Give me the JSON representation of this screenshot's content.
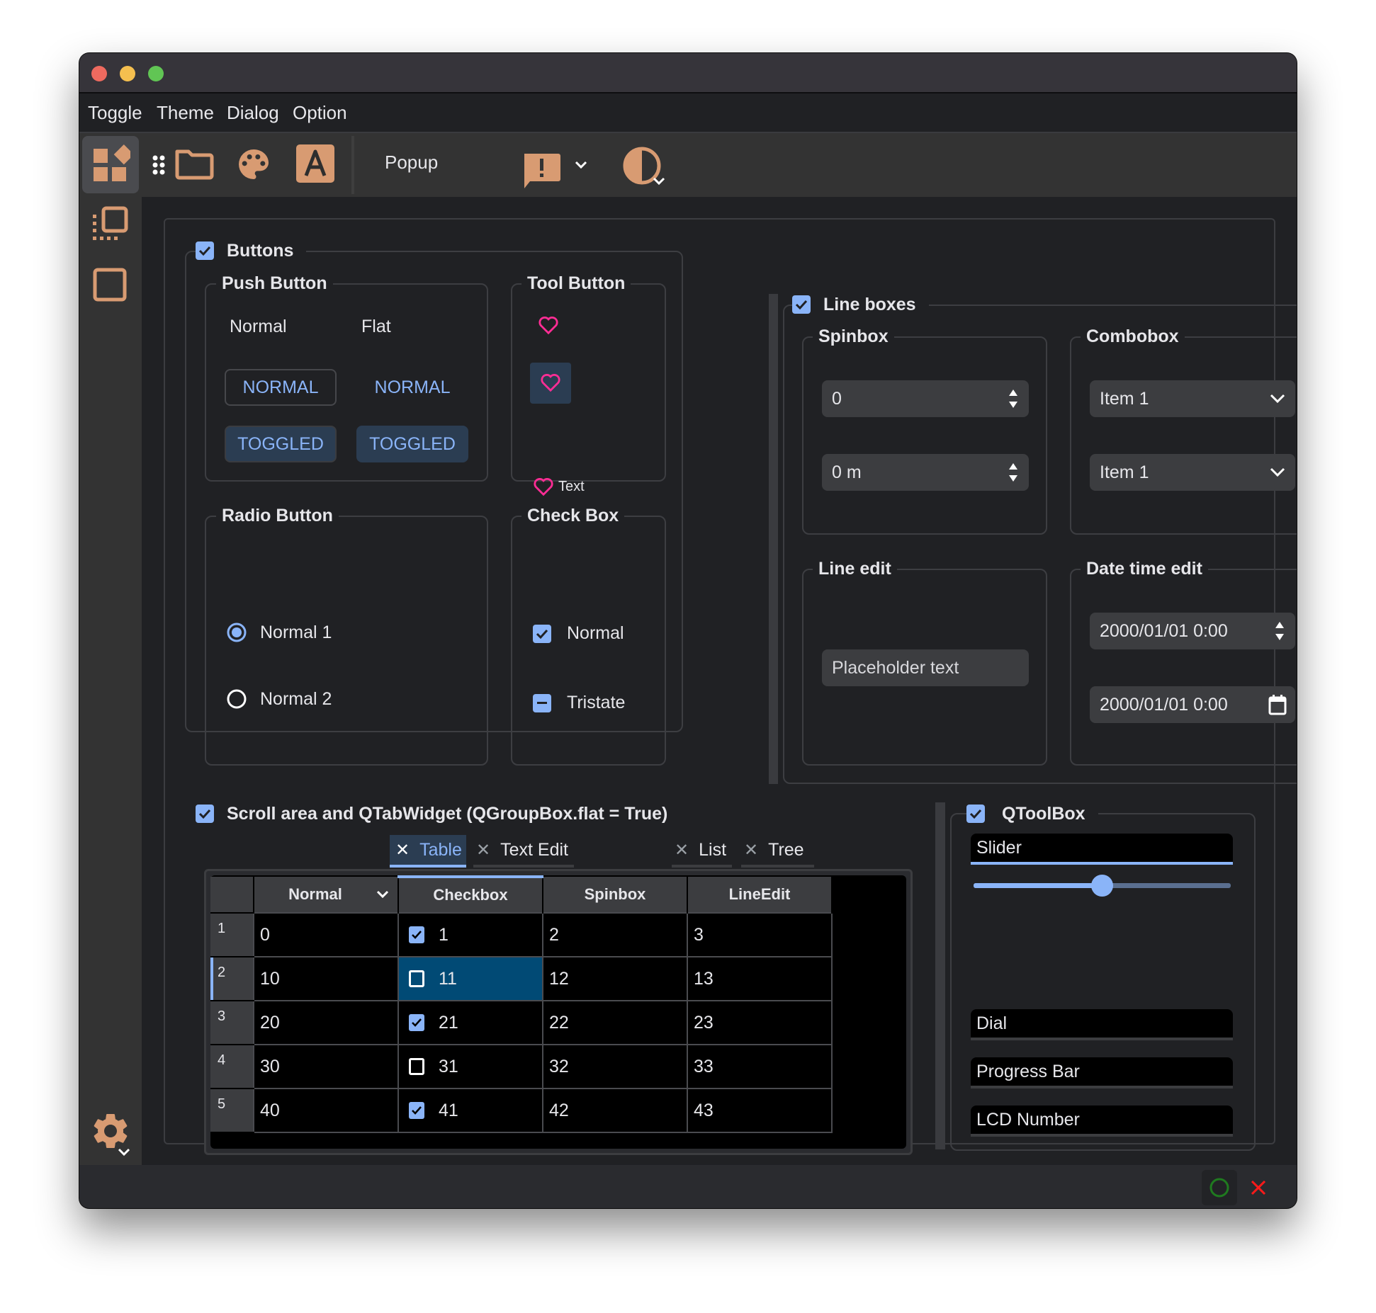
{
  "window": {
    "traffic_lights": [
      {
        "name": "close",
        "color": "#ee6a5f"
      },
      {
        "name": "minimize",
        "color": "#f5bf4f"
      },
      {
        "name": "zoom",
        "color": "#61c554"
      }
    ]
  },
  "menubar": {
    "items": [
      "Toggle",
      "Theme",
      "Dialog",
      "Option"
    ]
  },
  "toolbar": {
    "popup_label": "Popup",
    "icons": [
      "drag-handle-icon",
      "folder-icon",
      "palette-icon",
      "font-icon",
      "feedback-icon",
      "contrast-icon"
    ]
  },
  "sidebar": {
    "icons": [
      "widgets-icon",
      "flip-to-front-icon",
      "crop-square-icon",
      "settings-icon"
    ]
  },
  "colors": {
    "accent": "#d89b72",
    "primary": "#8ab4f8",
    "heart": "#ff2d95",
    "background": "#202124"
  },
  "buttons_group": {
    "title": "Buttons",
    "checked": true,
    "push_button": {
      "title": "Push Button",
      "col_labels": [
        "Normal",
        "Flat"
      ],
      "normal": [
        "NORMAL",
        "NORMAL"
      ],
      "toggled": [
        "TOGGLED",
        "TOGGLED"
      ]
    },
    "tool_button": {
      "title": "Tool Button",
      "text_label": "Text"
    },
    "radio_button": {
      "title": "Radio Button",
      "items": [
        {
          "label": "Normal 1",
          "checked": true
        },
        {
          "label": "Normal 2",
          "checked": false
        }
      ]
    },
    "check_box": {
      "title": "Check Box",
      "items": [
        {
          "label": "Normal",
          "state": "checked"
        },
        {
          "label": "Tristate",
          "state": "partial"
        }
      ]
    }
  },
  "line_boxes_group": {
    "title": "Line boxes",
    "checked": true,
    "spinbox": {
      "title": "Spinbox",
      "values": [
        "0",
        "0 m"
      ]
    },
    "combobox": {
      "title": "Combobox",
      "values": [
        "Item 1",
        "Item 1"
      ]
    },
    "line_edit": {
      "title": "Line edit",
      "placeholder": "Placeholder text"
    },
    "datetime_edit": {
      "title": "Date time edit",
      "values": [
        "2000/01/01 0:00",
        "2000/01/01 0:00"
      ]
    }
  },
  "scroll_group": {
    "title": "Scroll area and QTabWidget (QGroupBox.flat = True)",
    "checked": true,
    "tabs": [
      {
        "label": "Table",
        "active": true
      },
      {
        "label": "Text Edit",
        "active": false
      },
      {
        "label": "List",
        "active": false
      },
      {
        "label": "Tree",
        "active": false
      }
    ],
    "table": {
      "columns": [
        "Normal",
        "Checkbox",
        "Spinbox",
        "LineEdit"
      ],
      "rows": [
        {
          "header": "1",
          "cells": [
            "0",
            "1",
            "2",
            "3"
          ],
          "checked": true
        },
        {
          "header": "2",
          "cells": [
            "10",
            "11",
            "12",
            "13"
          ],
          "checked": false
        },
        {
          "header": "3",
          "cells": [
            "20",
            "21",
            "22",
            "23"
          ],
          "checked": true
        },
        {
          "header": "4",
          "cells": [
            "30",
            "31",
            "32",
            "33"
          ],
          "checked": false
        },
        {
          "header": "5",
          "cells": [
            "40",
            "41",
            "42",
            "43"
          ],
          "checked": true
        }
      ],
      "selected_row": 2,
      "selected_column": "Checkbox"
    }
  },
  "toolbox_group": {
    "title": "QToolBox",
    "checked": true,
    "items": [
      "Slider",
      "Dial",
      "Progress Bar",
      "LCD Number"
    ],
    "active_item": "Slider",
    "slider_value_fraction": 0.5
  },
  "statusbar": {
    "icons": [
      "circle-ok-icon",
      "close-x-icon"
    ]
  }
}
